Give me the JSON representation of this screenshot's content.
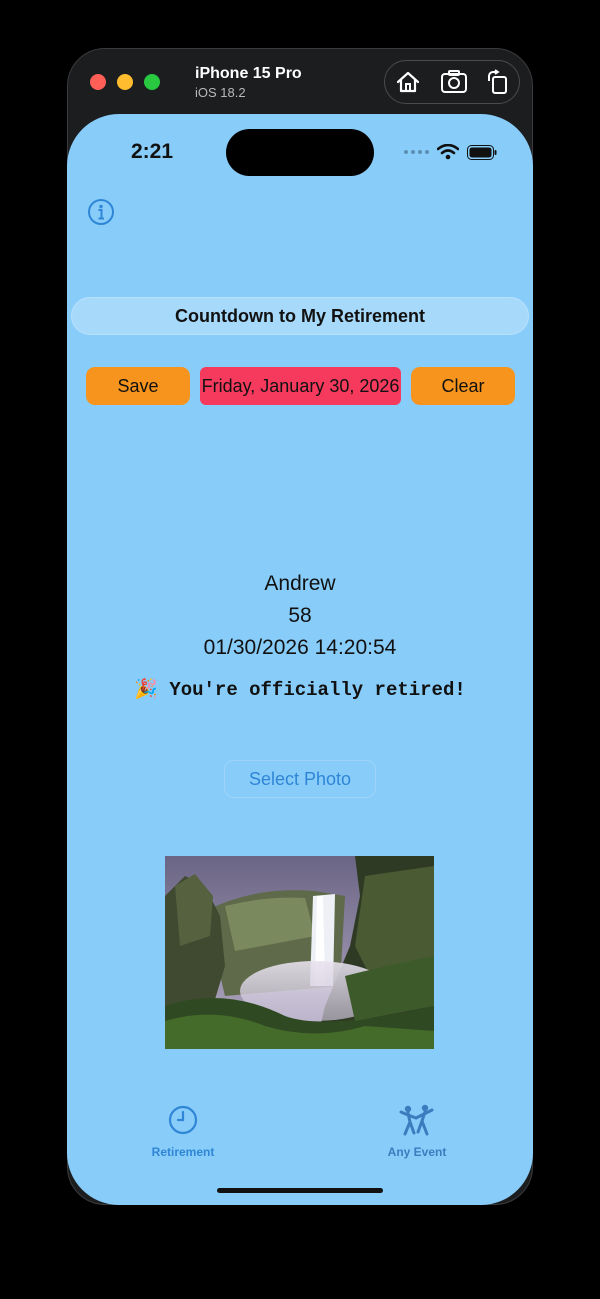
{
  "simulator": {
    "device_name": "iPhone 15 Pro",
    "os_version": "iOS 18.2",
    "tools": [
      "home-icon",
      "screenshot-icon",
      "rotate-icon"
    ]
  },
  "status_bar": {
    "time": "2:21",
    "icons": [
      "signal-dots-icon",
      "wifi-icon",
      "battery-icon"
    ]
  },
  "app": {
    "title": "Countdown to My Retirement",
    "save_label": "Save",
    "date_label": "Friday, January 30, 2026",
    "clear_label": "Clear",
    "name": "Andrew",
    "age": "58",
    "datetime": "01/30/2026 14:20:54",
    "retired_emoji": "🎉",
    "retired_message": "You're officially retired!",
    "select_photo_label": "Select Photo"
  },
  "tab_bar": {
    "items": [
      {
        "label": "Retirement",
        "icon": "clock-icon",
        "selected": true
      },
      {
        "label": "Any Event",
        "icon": "dancing-icon",
        "selected": false
      }
    ]
  },
  "colors": {
    "background": "#88ccf9",
    "accent_orange": "#f7941d",
    "date_red": "#f53a5e",
    "link_blue": "#2f86d6"
  }
}
